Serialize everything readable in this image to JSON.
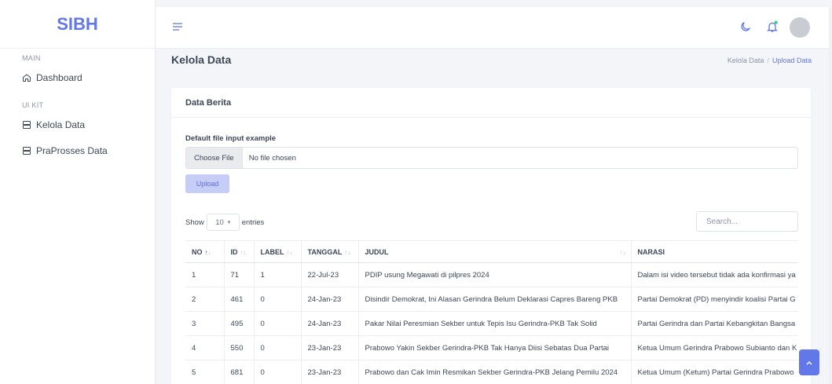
{
  "sidebar": {
    "brand": "SIBH",
    "sections": [
      {
        "label": "MAIN"
      },
      {
        "label": "UI KIT"
      }
    ],
    "items": [
      {
        "label": "Dashboard",
        "icon": "home-icon"
      },
      {
        "label": "Kelola Data",
        "icon": "server-icon"
      },
      {
        "label": "PraProsses Data",
        "icon": "server-icon"
      }
    ]
  },
  "topbar": {
    "icons": [
      "menu-icon",
      "moon-icon",
      "bell-icon",
      "avatar"
    ],
    "notification_color": "#2dce89"
  },
  "header": {
    "title": "Kelola Data",
    "breadcrumb": [
      "Kelola Data",
      "Upload Data"
    ]
  },
  "card": {
    "title": "Data Berita",
    "form_label": "Default file input example",
    "file_button": "Choose File",
    "file_status": "No file chosen",
    "upload_label": "Upload"
  },
  "table": {
    "show_label": "Show",
    "entries_value": "10",
    "entries_label": "entries",
    "search_placeholder": "Search...",
    "columns": [
      "NO",
      "ID",
      "LABEL",
      "TANGGAL",
      "JUDUL",
      "NARASI"
    ],
    "rows": [
      [
        "1",
        "71",
        "1",
        "22-Jul-23",
        "PDIP usung Megawati di pilpres 2024",
        "Dalam isi video tersebut tidak ada konfirmasi ya"
      ],
      [
        "2",
        "461",
        "0",
        "24-Jan-23",
        "Disindir Demokrat, Ini Alasan Gerindra Belum Deklarasi Capres Bareng PKB",
        "Partai Demokrat (PD) menyindir koalisi Partai G"
      ],
      [
        "3",
        "495",
        "0",
        "24-Jan-23",
        "Pakar Nilai Peresmian Sekber untuk Tepis Isu Gerindra-PKB Tak Solid",
        "Partai Gerindra dan Partai Kebangkitan Bangsa"
      ],
      [
        "4",
        "550",
        "0",
        "23-Jan-23",
        "Prabowo Yakin Sekber Gerindra-PKB Tak Hanya Diisi Sebatas Dua Partai",
        "Ketua Umum Gerindra Prabowo Subianto dan K"
      ],
      [
        "5",
        "681",
        "0",
        "23-Jan-23",
        "Prabowo dan Cak Imin Resmikan Sekber Gerindra-PKB Jelang Pemilu 2024",
        "Ketua Umum (Ketum) Partai Gerindra Prabowo"
      ]
    ]
  },
  "colors": {
    "accent": "#6378e8",
    "upload_bg": "#c6cdf6"
  }
}
